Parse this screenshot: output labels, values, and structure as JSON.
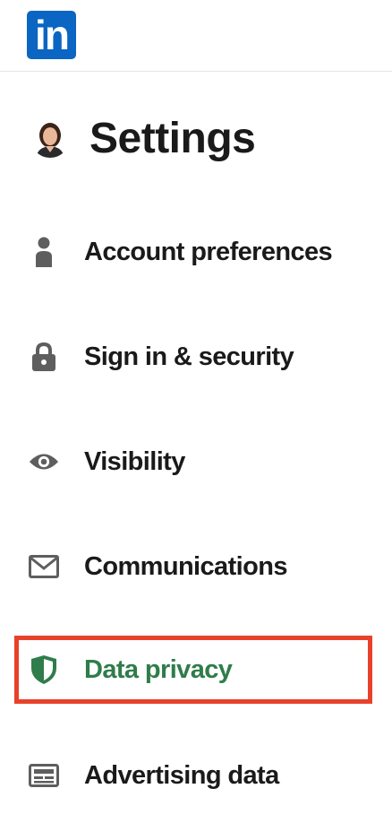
{
  "brand": {
    "logo_text": "in"
  },
  "header": {
    "title": "Settings"
  },
  "nav": {
    "items": [
      {
        "label": "Account preferences",
        "icon": "person-icon"
      },
      {
        "label": "Sign in & security",
        "icon": "lock-icon"
      },
      {
        "label": "Visibility",
        "icon": "eye-icon"
      },
      {
        "label": "Communications",
        "icon": "envelope-icon"
      },
      {
        "label": "Data privacy",
        "icon": "shield-icon",
        "active": true
      },
      {
        "label": "Advertising data",
        "icon": "ad-card-icon"
      }
    ]
  },
  "colors": {
    "brand": "#0a66c2",
    "active_text": "#2f7d4a",
    "highlight_border": "#e8412b",
    "icon_gray": "#5e5e5e"
  }
}
